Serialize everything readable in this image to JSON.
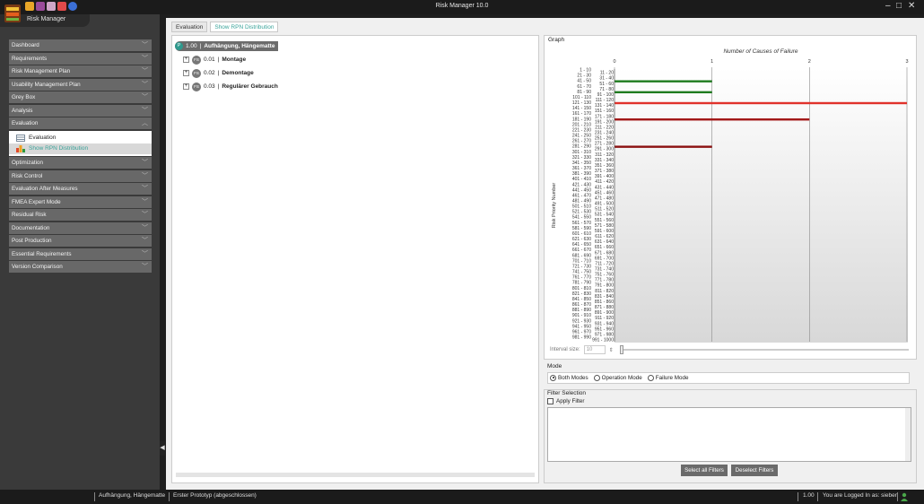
{
  "window": {
    "title": "Risk Manager   10.0",
    "min": "‒",
    "max": "□",
    "close": "✕"
  },
  "app": {
    "title": "Risk Manager"
  },
  "nav": {
    "items": [
      {
        "label": "Dashboard"
      },
      {
        "label": "Requirements"
      },
      {
        "label": "Risk Management Plan"
      },
      {
        "label": "Usability Management Plan"
      },
      {
        "label": "Grey Box"
      },
      {
        "label": "Analysis"
      },
      {
        "label": "Evaluation"
      },
      {
        "label": "Optimization"
      },
      {
        "label": "Risk Control"
      },
      {
        "label": "Evaluation After Measures"
      },
      {
        "label": "FMEA Expert Mode"
      },
      {
        "label": "Residual Risk"
      },
      {
        "label": "Documentation"
      },
      {
        "label": "Post Production"
      },
      {
        "label": "Essential Requirements"
      },
      {
        "label": "Version Comparison"
      }
    ],
    "sub": [
      "Evaluation",
      "Show RPN Distribution"
    ]
  },
  "breadcrumb": [
    "Evaluation",
    "Show RPN Distribution"
  ],
  "tree": {
    "root": {
      "badge": "P",
      "number": "1.00",
      "name": "Aufhängung, Hängematte"
    },
    "children": [
      {
        "expander": "+",
        "badge": "FS",
        "number": "0.01",
        "name": "Montage"
      },
      {
        "expander": "+",
        "badge": "FS",
        "number": "0.02",
        "name": "Demontage"
      },
      {
        "expander": "+",
        "badge": "FS",
        "number": "0.03",
        "name": "Regulärer Gebrauch"
      }
    ]
  },
  "graph": {
    "label": "Graph",
    "interval_label": "Interval size:",
    "interval_value": "10"
  },
  "chart_data": {
    "type": "bar",
    "orientation": "horizontal",
    "title": "Number of Causes of Failure",
    "ylabel": "Risk Priority Number",
    "xlim": [
      0,
      3
    ],
    "xticks": [
      0,
      1,
      2,
      3
    ],
    "categories": [
      "1 - 10",
      "11 - 20",
      "21 - 30",
      "31 - 40",
      "41 - 50",
      "51 - 60",
      "61 - 70",
      "71 - 80",
      "81 - 90",
      "91 - 100",
      "101 - 110",
      "111 - 120",
      "121 - 130",
      "131 - 140",
      "141 - 150",
      "151 - 160",
      "161 - 170",
      "171 - 180",
      "181 - 190",
      "191 - 200",
      "201 - 210",
      "211 - 220",
      "221 - 230",
      "231 - 240",
      "241 - 250",
      "251 - 260",
      "261 - 270",
      "271 - 280",
      "281 - 290",
      "291 - 300",
      "301 - 310",
      "311 - 320",
      "321 - 330",
      "331 - 340",
      "341 - 350",
      "351 - 360",
      "361 - 370",
      "371 - 380",
      "381 - 390",
      "391 - 400",
      "401 - 410",
      "411 - 420",
      "421 - 430",
      "431 - 440",
      "441 - 450",
      "451 - 460",
      "461 - 470",
      "471 - 480",
      "481 - 490",
      "491 - 500",
      "501 - 510",
      "511 - 520",
      "521 - 530",
      "531 - 540",
      "541 - 550",
      "551 - 560",
      "561 - 570",
      "571 - 580",
      "581 - 590",
      "591 - 600",
      "601 - 610",
      "611 - 620",
      "621 - 630",
      "631 - 640",
      "641 - 650",
      "651 - 660",
      "661 - 670",
      "671 - 680",
      "681 - 690",
      "691 - 700",
      "701 - 710",
      "711 - 720",
      "721 - 730",
      "731 - 740",
      "741 - 750",
      "751 - 760",
      "761 - 770",
      "771 - 780",
      "781 - 790",
      "791 - 800",
      "801 - 810",
      "811 - 820",
      "821 - 830",
      "831 - 840",
      "841 - 850",
      "851 - 860",
      "861 - 870",
      "871 - 880",
      "881 - 890",
      "891 - 900",
      "901 - 910",
      "911 - 920",
      "921 - 930",
      "931 - 940",
      "941 - 950",
      "951 - 960",
      "961 - 970",
      "971 - 980",
      "981 - 990",
      "991 - 1000"
    ],
    "values": [
      0,
      0,
      0,
      0,
      1,
      0,
      0,
      0,
      1,
      0,
      0,
      0,
      3,
      0,
      0,
      0,
      0,
      0,
      2,
      0,
      0,
      0,
      0,
      0,
      0,
      0,
      0,
      0,
      1,
      0,
      0,
      0,
      0,
      0,
      0,
      0,
      0,
      0,
      0,
      0,
      0,
      0,
      0,
      0,
      0,
      0,
      0,
      0,
      0,
      0,
      0,
      0,
      0,
      0,
      0,
      0,
      0,
      0,
      0,
      0,
      0,
      0,
      0,
      0,
      0,
      0,
      0,
      0,
      0,
      0,
      0,
      0,
      0,
      0,
      0,
      0,
      0,
      0,
      0,
      0,
      0,
      0,
      0,
      0,
      0,
      0,
      0,
      0,
      0,
      0,
      0,
      0,
      0,
      0,
      0,
      0,
      0,
      0,
      0,
      0
    ],
    "bar_colors": {
      "41 - 50": "#1e7b1e",
      "81 - 90": "#1e7b1e",
      "121 - 130": "#e0322b",
      "181 - 190": "#a11515",
      "281 - 290": "#8b1010"
    },
    "grid": true
  },
  "mode": {
    "label": "Mode",
    "options": [
      {
        "label": "Both Modes",
        "selected": true
      },
      {
        "label": "Operation Mode",
        "selected": false
      },
      {
        "label": "Failure Mode",
        "selected": false
      }
    ]
  },
  "filter": {
    "label": "Filter Selection",
    "apply": "Apply Filter",
    "select_all": "Select all Filters",
    "deselect": "Deselect Filters"
  },
  "status": {
    "left": "Aufhängung, Hängematte",
    "middle": "Erster Prototyp (abgeschlossen)",
    "version": "1.00",
    "user": "You are Logged In as: sieber"
  },
  "colors": {
    "accent": "#3aa39a",
    "nav_bg": "#686868",
    "dark": "#1b1b1b"
  }
}
